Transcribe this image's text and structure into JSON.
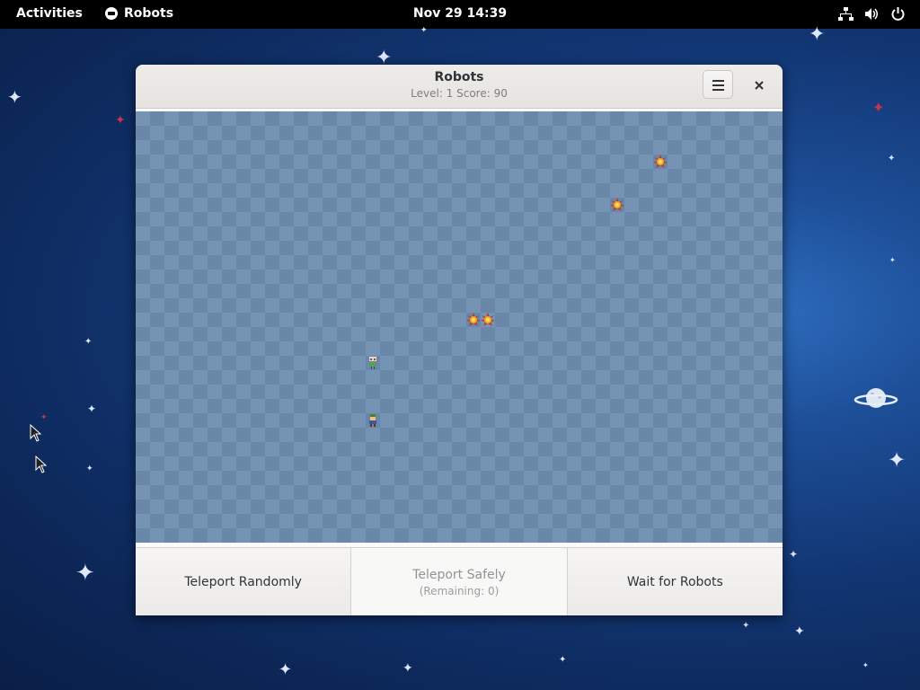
{
  "topbar": {
    "activities": "Activities",
    "app_name": "Robots",
    "clock": "Nov 29  14:39",
    "tray_icons": [
      "network-icon",
      "volume-icon",
      "power-icon"
    ]
  },
  "window": {
    "title": "Robots",
    "subtitle": "Level: 1   Score: 90",
    "menu_icon": "hamburger-menu-icon",
    "close_icon": "close-icon"
  },
  "board": {
    "grid": {
      "columns": 45,
      "rows": 30
    },
    "pieces": [
      {
        "type": "explosion",
        "col": 36,
        "row": 3
      },
      {
        "type": "explosion",
        "col": 33,
        "row": 6
      },
      {
        "type": "explosion",
        "col": 23,
        "row": 14
      },
      {
        "type": "explosion",
        "col": 24,
        "row": 14
      },
      {
        "type": "robot",
        "col": 16,
        "row": 17
      },
      {
        "type": "player",
        "col": 16,
        "row": 21
      }
    ]
  },
  "actions": {
    "teleport_randomly": "Teleport Randomly",
    "teleport_safely": "Teleport Safely",
    "teleport_safely_remaining": "(Remaining: 0)",
    "wait_for_robots": "Wait for Robots"
  },
  "colors": {
    "board_light": "#7593b3",
    "board_dark": "#6987a8",
    "topbar": "#000000"
  }
}
